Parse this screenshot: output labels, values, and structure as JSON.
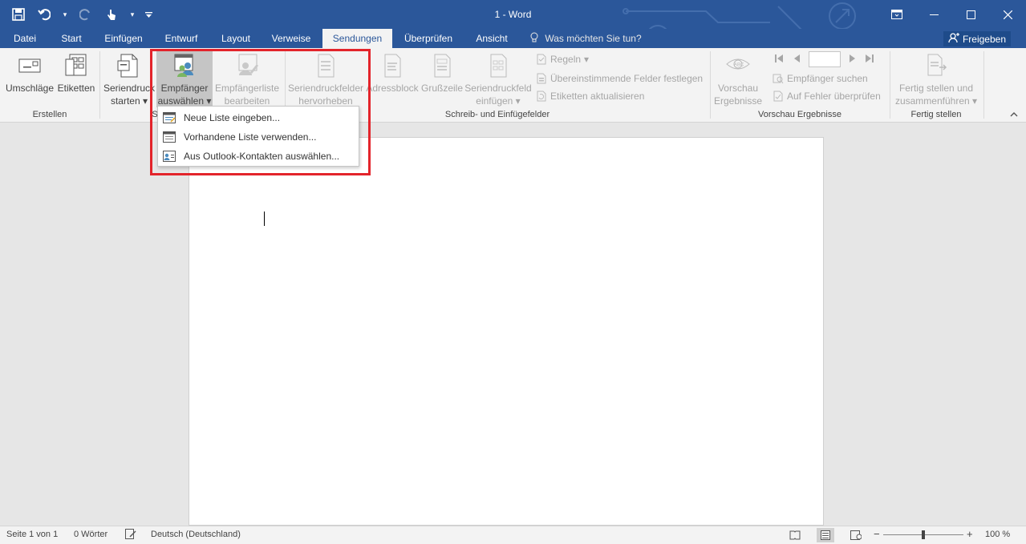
{
  "window": {
    "title": "1 - Word",
    "controls": [
      "ribbon-options",
      "minimize",
      "maximize",
      "close"
    ]
  },
  "qat": {
    "icons": [
      "save-icon",
      "undo-icon",
      "redo-icon",
      "touch-mode-icon",
      "customize-qat-icon"
    ]
  },
  "tabs": [
    "Datei",
    "Start",
    "Einfügen",
    "Entwurf",
    "Layout",
    "Verweise",
    "Sendungen",
    "Überprüfen",
    "Ansicht"
  ],
  "active_tab": "Sendungen",
  "tell_me": "Was möchten Sie tun?",
  "share_label": "Freigeben",
  "ribbon": {
    "erstellen": {
      "label": "Erstellen",
      "umschlaege": "Umschläge",
      "etiketten": "Etiketten"
    },
    "start_merge": {
      "label": "S",
      "seriendruck_line1": "Seriendruck",
      "seriendruck_line2": "starten",
      "empfaenger_line1": "Empfänger",
      "empfaenger_line2": "auswählen",
      "liste_line1": "Empfängerliste",
      "liste_line2": "bearbeiten"
    },
    "felder": {
      "label": "Schreib- und Einfügefelder",
      "hervorheben_line1": "Seriendruckfelder",
      "hervorheben_line2": "hervorheben",
      "adressblock": "Adressblock",
      "grusszeile": "Grußzeile",
      "einfuegen_line1": "Seriendruckfeld",
      "einfuegen_line2": "einfügen",
      "regeln": "Regeln",
      "felder_festlegen": "Übereinstimmende Felder festlegen",
      "etiketten_aktualisieren": "Etiketten aktualisieren"
    },
    "vorschau": {
      "label": "Vorschau Ergebnisse",
      "btn_line1": "Vorschau",
      "btn_line2": "Ergebnisse",
      "suchen": "Empfänger suchen",
      "fehler": "Auf Fehler überprüfen"
    },
    "fertig": {
      "label": "Fertig stellen",
      "btn_line1": "Fertig stellen und",
      "btn_line2": "zusammenführen"
    }
  },
  "dropdown": {
    "items": [
      "Neue Liste eingeben...",
      "Vorhandene Liste verwenden...",
      "Aus Outlook-Kontakten auswählen..."
    ]
  },
  "status": {
    "page": "Seite 1 von 1",
    "words": "0 Wörter",
    "language": "Deutsch (Deutschland)",
    "zoom": "100 %",
    "zoom_value": 100
  },
  "colors": {
    "brand": "#2b579a",
    "highlight": "#e3242b"
  }
}
